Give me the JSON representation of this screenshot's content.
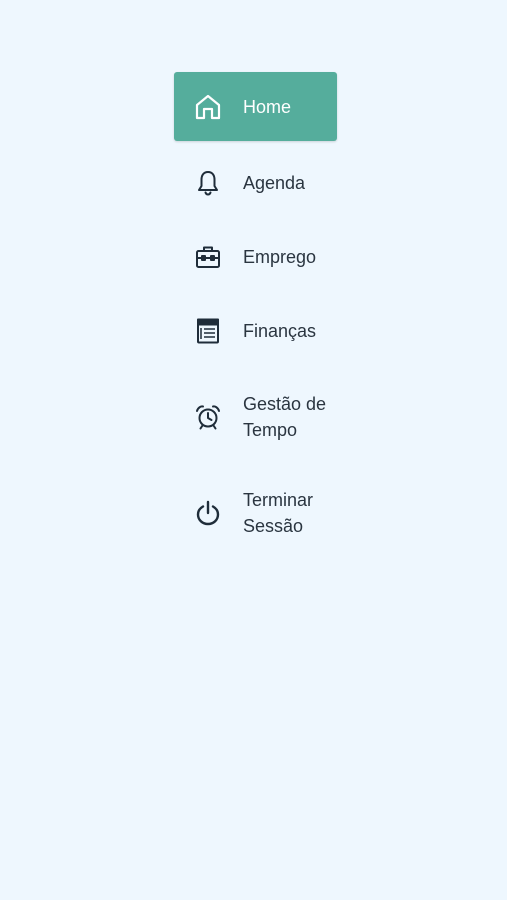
{
  "menu": {
    "items": [
      {
        "label": "Home",
        "icon": "home-icon",
        "active": true
      },
      {
        "label": "Agenda",
        "icon": "bell-icon",
        "active": false
      },
      {
        "label": "Emprego",
        "icon": "briefcase-icon",
        "active": false
      },
      {
        "label": "Finanças",
        "icon": "ledger-icon",
        "active": false
      },
      {
        "label": "Gestão de Tempo",
        "icon": "alarm-clock-icon",
        "active": false
      },
      {
        "label": "Terminar Sessão",
        "icon": "power-icon",
        "active": false
      }
    ]
  },
  "colors": {
    "background": "#eef7fe",
    "active_bg": "#55ad9c",
    "text": "#2a3540",
    "icon": "#1f2d3a"
  }
}
